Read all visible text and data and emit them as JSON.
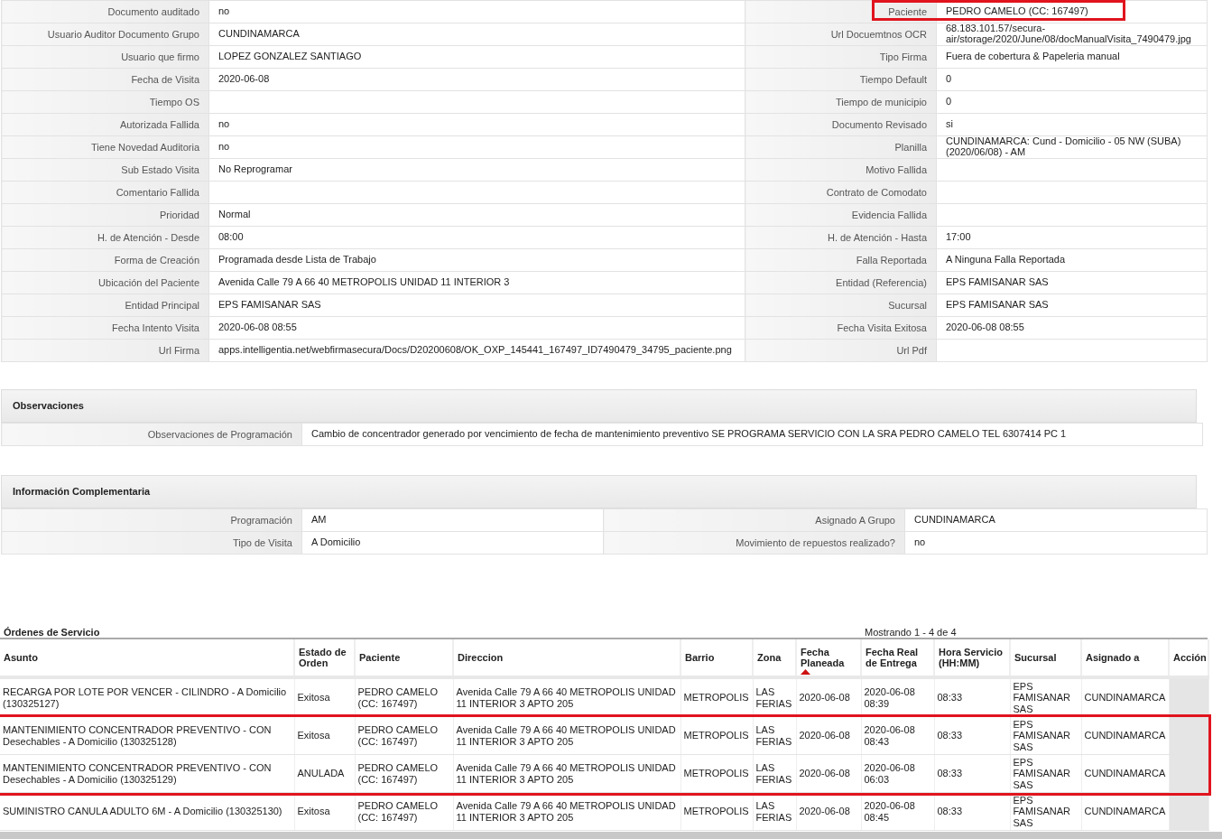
{
  "detail_fields": [
    {
      "left_label": "Documento auditado",
      "left_value": "no",
      "right_label": "Paciente",
      "right_value": "PEDRO CAMELO (CC: 167497)",
      "right_highlighted": true
    },
    {
      "left_label": "Usuario Auditor Documento Grupo",
      "left_value": "CUNDINAMARCA",
      "right_label": "Url Docuemtnos OCR",
      "right_value": "68.183.101.57/secura-air/storage/2020/June/08/docManualVisita_7490479.jpg",
      "right_highlighted": false
    },
    {
      "left_label": "Usuario que firmo",
      "left_value": "LOPEZ GONZALEZ SANTIAGO",
      "right_label": "Tipo Firma",
      "right_value": "Fuera de cobertura & Papeleria manual",
      "right_highlighted": false
    },
    {
      "left_label": "Fecha de Visita",
      "left_value": "2020-06-08",
      "right_label": "Tiempo Default",
      "right_value": "0",
      "right_highlighted": false
    },
    {
      "left_label": "Tiempo OS",
      "right_label": "Tiempo de municipio",
      "right_value": "0",
      "right_highlighted": false
    },
    {
      "left_label": "Autorizada Fallida",
      "left_value": "no",
      "right_label": "Documento Revisado",
      "right_value": "si",
      "right_highlighted": false
    },
    {
      "left_label": "Tiene Novedad Auditoria",
      "left_value": "no",
      "right_label": "Planilla",
      "right_value": "CUNDINAMARCA: Cund - Domicilio - 05 NW (SUBA) (2020/06/08) - AM",
      "right_highlighted": false
    },
    {
      "left_label": "Sub Estado Visita",
      "left_value": "No Reprogramar",
      "right_label": "Motivo Fallida",
      "right_highlighted": false
    },
    {
      "left_label": "Comentario Fallida",
      "right_label": "Contrato de Comodato",
      "right_highlighted": false
    },
    {
      "left_label": "Prioridad",
      "left_value": "Normal",
      "right_label": "Evidencia Fallida",
      "right_highlighted": false
    },
    {
      "left_label": "H. de Atención - Desde",
      "left_value": "08:00",
      "right_label": "H. de Atención - Hasta",
      "right_value": "17:00",
      "right_highlighted": false
    },
    {
      "left_label": "Forma de Creación",
      "left_value": "Programada desde Lista de Trabajo",
      "right_label": "Falla Reportada",
      "right_value": "A Ninguna Falla Reportada",
      "right_highlighted": false
    },
    {
      "left_label": "Ubicación del Paciente",
      "left_value": "Avenida Calle 79 A 66 40 METROPOLIS UNIDAD 11 INTERIOR 3",
      "right_label": "Entidad (Referencia)",
      "right_value": "EPS FAMISANAR SAS",
      "right_highlighted": false
    },
    {
      "left_label": "Entidad Principal",
      "left_value": "EPS FAMISANAR SAS",
      "right_label": "Sucursal",
      "right_value": "EPS FAMISANAR SAS",
      "right_highlighted": false
    },
    {
      "left_label": "Fecha Intento Visita",
      "left_value": "2020-06-08 08:55",
      "right_label": "Fecha Visita Exitosa",
      "right_value": "2020-06-08 08:55",
      "right_highlighted": false
    },
    {
      "left_label": "Url Firma",
      "left_value": "apps.intelligentia.net/webfirmasecura/Docs/D20200608/OK_OXP_145441_167497_ID7490479_34795_paciente.png",
      "right_label": "Url Pdf",
      "right_highlighted": false
    }
  ],
  "observaciones": {
    "title": "Observaciones",
    "label": "Observaciones de Programación",
    "value": "Cambio de concentrador generado por vencimiento de fecha de mantenimiento preventivo SE PROGRAMA SERVICIO CON LA SRA PEDRO CAMELO TEL 6307414 PC 1"
  },
  "informacion_complementaria": {
    "title": "Información Complementaria",
    "rows": [
      {
        "left_label": "Programación",
        "left_value": "AM",
        "right_label": "Asignado A Grupo",
        "right_value": "CUNDINAMARCA"
      },
      {
        "left_label": "Tipo de Visita",
        "left_value": "A Domicilio",
        "right_label": "Movimiento de repuestos realizado?",
        "right_value": "no"
      }
    ]
  },
  "ordenes": {
    "title": "Órdenes de Servicio",
    "paging": "Mostrando 1 - 4 de 4",
    "columns": [
      {
        "label": "Asunto",
        "sorted": false
      },
      {
        "label": "Estado de Orden",
        "sorted": false
      },
      {
        "label": "Paciente",
        "sorted": false
      },
      {
        "label": "Direccion",
        "sorted": false
      },
      {
        "label": "Barrio",
        "sorted": false
      },
      {
        "label": "Zona",
        "sorted": false
      },
      {
        "label": "Fecha Planeada",
        "sorted": true
      },
      {
        "label": "Fecha Real de Entrega",
        "sorted": false
      },
      {
        "label": "Hora Servicio (HH:MM)",
        "sorted": false
      },
      {
        "label": "Sucursal",
        "sorted": false
      },
      {
        "label": "Asignado a",
        "sorted": false
      },
      {
        "label": "Acción",
        "sorted": false
      }
    ],
    "rows": [
      {
        "highlighted": false,
        "cells": [
          "RECARGA POR LOTE POR VENCER - CILINDRO - A Domicilio (130325127)",
          "Exitosa",
          "PEDRO CAMELO (CC: 167497)",
          "Avenida Calle 79 A 66 40 METROPOLIS UNIDAD 11 INTERIOR 3 APTO 205",
          "METROPOLIS",
          "LAS FERIAS",
          "2020-06-08",
          "2020-06-08 08:39",
          "08:33",
          "EPS FAMISANAR SAS",
          "CUNDINAMARCA"
        ]
      },
      {
        "highlighted": true,
        "cells": [
          "MANTENIMIENTO CONCENTRADOR PREVENTIVO - CON Desechables - A Domicilio (130325128)",
          "Exitosa",
          "PEDRO CAMELO (CC: 167497)",
          "Avenida Calle 79 A 66 40 METROPOLIS UNIDAD 11 INTERIOR 3 APTO 205",
          "METROPOLIS",
          "LAS FERIAS",
          "2020-06-08",
          "2020-06-08 08:43",
          "08:33",
          "EPS FAMISANAR SAS",
          "CUNDINAMARCA"
        ]
      },
      {
        "highlighted": true,
        "cells": [
          "MANTENIMIENTO CONCENTRADOR PREVENTIVO - CON Desechables - A Domicilio (130325129)",
          "ANULADA",
          "PEDRO CAMELO (CC: 167497)",
          "Avenida Calle 79 A 66 40 METROPOLIS UNIDAD 11 INTERIOR 3 APTO 205",
          "METROPOLIS",
          "LAS FERIAS",
          "2020-06-08",
          "2020-06-08 06:03",
          "08:33",
          "EPS FAMISANAR SAS",
          "CUNDINAMARCA"
        ]
      },
      {
        "highlighted": false,
        "cells": [
          "SUMINISTRO CANULA ADULTO 6M - A Domicilio (130325130)",
          "Exitosa",
          "PEDRO CAMELO (CC: 167497)",
          "Avenida Calle 79 A 66 40 METROPOLIS UNIDAD 11 INTERIOR 3 APTO 205",
          "METROPOLIS",
          "LAS FERIAS",
          "2020-06-08",
          "2020-06-08 08:45",
          "08:33",
          "EPS FAMISANAR SAS",
          "CUNDINAMARCA"
        ]
      }
    ]
  }
}
